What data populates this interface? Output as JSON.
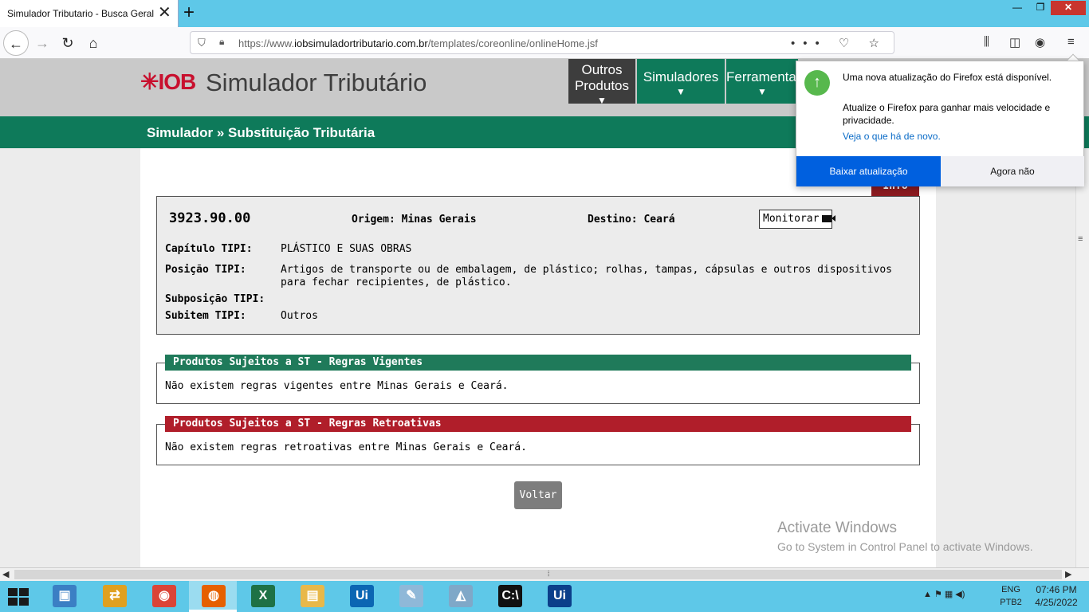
{
  "browser": {
    "tab_title": "Simulador Tributario - Busca Geral",
    "tab_close": "✕",
    "new_tab": "+",
    "window": {
      "minimize": "—",
      "maximize": "❐",
      "close": "✕"
    },
    "nav": {
      "back": "←",
      "forward": "→",
      "reload": "↻",
      "home": "⌂"
    },
    "url_prefix": "https://www.",
    "url_domain": "iobsimuladortributario.com.br",
    "url_path": "/templates/coreonline/onlineHome.jsf",
    "url_actions": "••• ♡ ☆",
    "toolbar": {
      "library": "⫼",
      "sidebar": "◫",
      "account": "◉",
      "menu": "≡"
    }
  },
  "header": {
    "logo": "✳IOB",
    "title": "Simulador Tributário",
    "menu": [
      {
        "label": "Outros Produtos",
        "arrow": "▼"
      },
      {
        "label": "Simuladores",
        "arrow": "▼"
      },
      {
        "label": "Ferramentas",
        "arrow": "▼"
      }
    ]
  },
  "breadcrumb": "Simulador » Substituição Tributária",
  "info_tag": "Info",
  "product": {
    "ncm": "3923.90.00",
    "origem": "Origem: Minas Gerais",
    "destino": "Destino: Ceará",
    "monitor_label": "Monitorar",
    "rows": [
      {
        "label": "Capítulo TIPI:",
        "value": "PLÁSTICO E SUAS OBRAS"
      },
      {
        "label": "Posição TIPI:",
        "value": "Artigos de transporte ou de embalagem, de plástico; rolhas, tampas, cápsulas e outros dispositivos para fechar recipientes, de plástico."
      },
      {
        "label": "Subposição TIPI:",
        "value": ""
      },
      {
        "label": "Subitem TIPI:",
        "value": "Outros"
      }
    ]
  },
  "rules": {
    "vigentes": {
      "title": "Produtos Sujeitos a ST - Regras Vigentes",
      "text": "Não existem regras vigentes entre Minas Gerais e Ceará."
    },
    "retroativas": {
      "title": "Produtos Sujeitos a ST - Regras Retroativas",
      "text": "Não existem regras retroativas entre Minas Gerais e Ceará."
    }
  },
  "back_button": "Voltar",
  "watermark": {
    "line1": "Activate Windows",
    "line2": "Go to System in Control Panel to activate Windows."
  },
  "update_popup": {
    "title": "Uma nova atualização do Firefox está disponível.",
    "body": "Atualize o Firefox para ganhar mais velocidade e privacidade.",
    "link": "Veja o que há de novo.",
    "primary": "Baixar atualização",
    "secondary": "Agora não"
  },
  "taskbar": {
    "apps": [
      {
        "name": "network-icon",
        "color": "#3b7fc4",
        "glyph": "▣"
      },
      {
        "name": "remote-desktop-icon",
        "color": "#e0a020",
        "glyph": "⇄"
      },
      {
        "name": "chrome-icon",
        "color": "#db4437",
        "glyph": "◉"
      },
      {
        "name": "firefox-icon",
        "color": "#e66000",
        "glyph": "◍",
        "active": true
      },
      {
        "name": "excel-icon",
        "color": "#1e7145",
        "glyph": "X"
      },
      {
        "name": "file-explorer-icon",
        "color": "#e8b84a",
        "glyph": "▤"
      },
      {
        "name": "uipath-icon",
        "color": "#0b66b3",
        "glyph": "Ui"
      },
      {
        "name": "notepad-icon",
        "color": "#8fb8d8",
        "glyph": "✎"
      },
      {
        "name": "performance-icon",
        "color": "#7fa8c8",
        "glyph": "◭"
      },
      {
        "name": "cmd-icon",
        "color": "#111111",
        "glyph": "C:\\"
      },
      {
        "name": "uipath-studio-icon",
        "color": "#0b3f8a",
        "glyph": "Ui"
      }
    ],
    "tray_icons": "▲ ⚑ ▦ ◀)",
    "lang_line1": "ENG",
    "lang_line2": "PTB2",
    "time": "07:46 PM",
    "date": "4/25/2022"
  },
  "colors": {
    "brand_green": "#0e7a5a",
    "brand_red": "#b01e2a",
    "firefox_blue": "#0060df"
  }
}
